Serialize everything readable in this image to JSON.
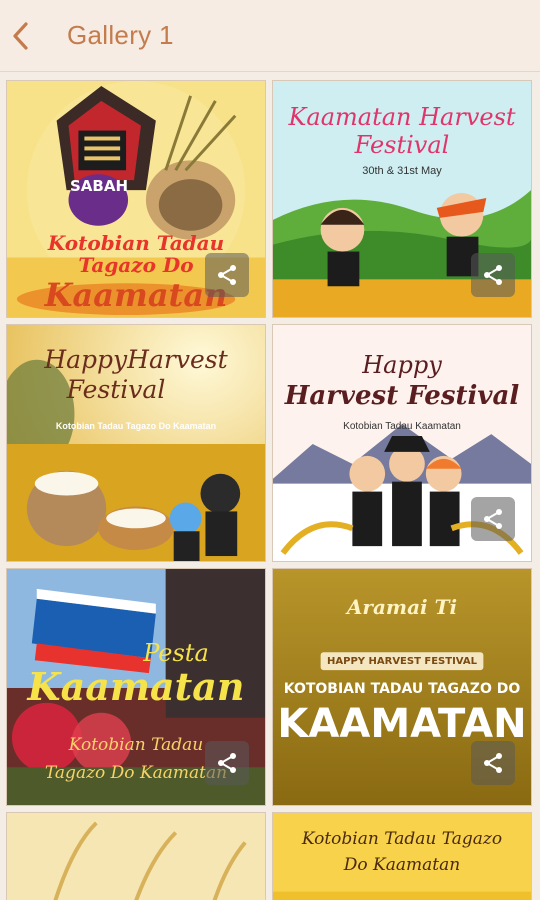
{
  "header": {
    "title": "Gallery 1",
    "back_icon": "chevron-left-icon",
    "accent": "#c47c4c"
  },
  "gallery": {
    "tiles": [
      {
        "badge": "SABAH",
        "line1": "Kotobian Tadau",
        "line2": "Tagazo Do",
        "line3": "Kaamatan",
        "share_icon": "share-icon"
      },
      {
        "title_line1": "Kaamatan Harvest",
        "title_line2": "Festival",
        "date": "30th & 31st May",
        "share_icon": "share-icon"
      },
      {
        "title_line1": "HappyHarvest",
        "title_line2": "Festival",
        "subtitle": "Kotobian Tadau Tagazo Do Kaamatan",
        "share_icon": "share-icon"
      },
      {
        "title_line1": "Happy",
        "title_line2": "Harvest Festival",
        "subtitle": "Kotobian Tadau Kaamatan",
        "share_icon": "share-icon"
      },
      {
        "title_line1": "Pesta",
        "title_line2": "Kaamatan",
        "line3": "Kotobian Tadau",
        "line4": "Tagazo Do Kaamatan",
        "share_icon": "share-icon"
      },
      {
        "badge": "Aramai Ti",
        "banner": "HAPPY HARVEST FESTIVAL",
        "line1": "KOTOBIAN TADAU TAGAZO DO",
        "line2": "KAAMATAN",
        "share_icon": "share-icon"
      },
      {
        "share_icon": "share-icon"
      },
      {
        "line1": "Kotobian Tadau Tagazo",
        "line2": "Do Kaamatan",
        "share_icon": "share-icon"
      }
    ]
  }
}
